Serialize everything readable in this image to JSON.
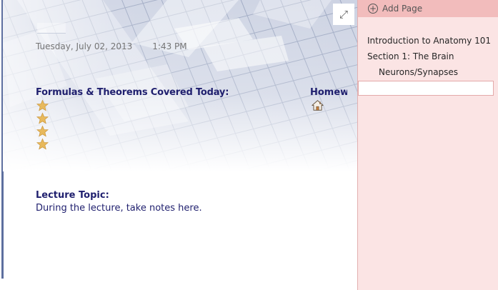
{
  "note": {
    "date": "Tuesday, July 02, 2013",
    "time": "1:43 PM",
    "formulas_heading": "Formulas & Theorems Covered Today:",
    "homework_heading": "Homework",
    "lecture_heading": "Lecture Topic:",
    "lecture_body": "During the lecture, take notes here.",
    "star_count": 4,
    "icons": [
      "expand-icon",
      "star-icon",
      "house-icon"
    ]
  },
  "pages_pane": {
    "add_page_label": "Add Page",
    "pages": [
      {
        "label": "Introduction to Anatomy 101",
        "level": 0
      },
      {
        "label": "Section 1: The Brain",
        "level": 0
      },
      {
        "label": "Neurons/Synapses",
        "level": 1
      }
    ]
  },
  "colors": {
    "heading_text": "#1f1f6e",
    "pane_background": "#fbe4e4",
    "add_page_bar": "#f2bcbc",
    "star": "#e8b95c"
  }
}
